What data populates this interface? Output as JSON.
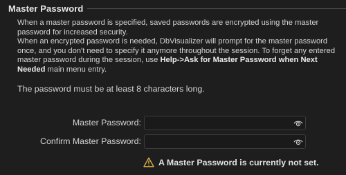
{
  "section": {
    "title": "Master Password"
  },
  "description": {
    "line1": "When a master password is specified, saved passwords are encrypted using the master password for increased security.",
    "line2_pre": "When an encrypted password is needed, DbVisualizer will prompt for the master password once, and you don't need to specify it anymore throughout the session. To forget any entered master password during the session, use ",
    "line2_bold": "Help->Ask for Master Password when Next Needed",
    "line2_post": " main menu entry."
  },
  "requirement_text": "The password must be at least 8 characters long.",
  "fields": {
    "master": {
      "label": "Master Password:",
      "value": "",
      "icon": "eye-icon"
    },
    "confirm": {
      "label": "Confirm Master Password:",
      "value": "",
      "icon": "eye-icon"
    }
  },
  "status": {
    "icon": "warning-icon",
    "text": "A Master Password is currently not set.",
    "icon_color": "#e0b34a"
  }
}
